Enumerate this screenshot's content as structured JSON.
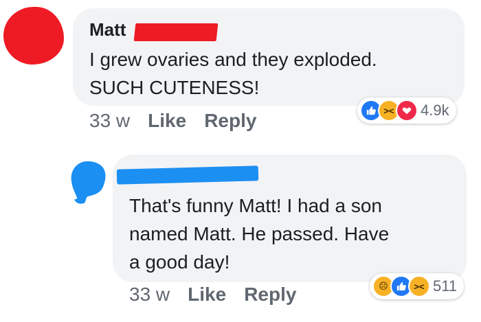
{
  "comment1": {
    "author": "Matt",
    "text_line1": "I grew ovaries and they exploded.",
    "text_line2": "SUCH CUTENESS!",
    "time": "33 w",
    "like_label": "Like",
    "reply_label": "Reply",
    "reaction_count": "4.9k",
    "reactions": [
      "like-icon",
      "haha-icon",
      "love-icon"
    ]
  },
  "comment2": {
    "text_line1": "That's funny Matt! I had a son",
    "text_line2": "named Matt. He passed. Have",
    "text_line3": "a good day!",
    "time": "33 w",
    "like_label": "Like",
    "reply_label": "Reply",
    "reaction_count": "511",
    "reactions": [
      "sad-icon",
      "like-icon",
      "haha-icon"
    ]
  },
  "colors": {
    "bubble": "#f2f3f5",
    "meta_text": "#606770",
    "redaction_red": "#ee1b24",
    "redaction_blue": "#1c8ff2",
    "like_blue": "#2078f4",
    "love_red": "#f0284a",
    "emoji_yellow": "#f7b125"
  }
}
